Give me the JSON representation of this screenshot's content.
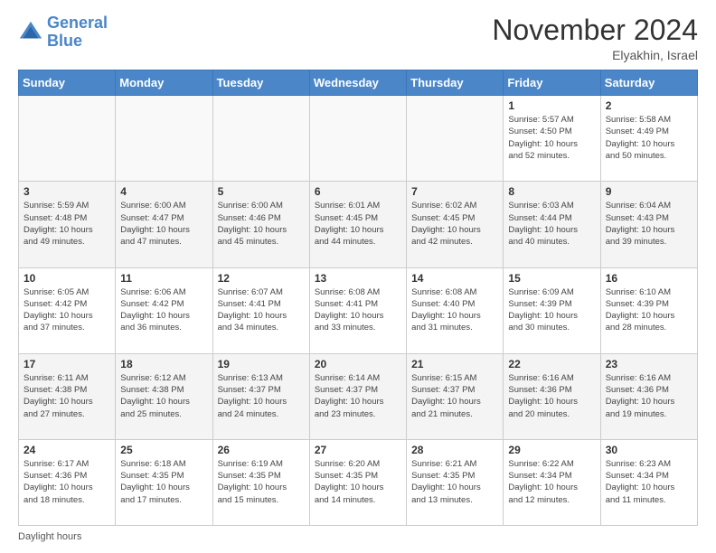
{
  "logo": {
    "line1": "General",
    "line2": "Blue"
  },
  "header": {
    "month": "November 2024",
    "location": "Elyakhin, Israel"
  },
  "footer": {
    "daylight_label": "Daylight hours"
  },
  "weekdays": [
    "Sunday",
    "Monday",
    "Tuesday",
    "Wednesday",
    "Thursday",
    "Friday",
    "Saturday"
  ],
  "weeks": [
    [
      {
        "day": "",
        "info": ""
      },
      {
        "day": "",
        "info": ""
      },
      {
        "day": "",
        "info": ""
      },
      {
        "day": "",
        "info": ""
      },
      {
        "day": "",
        "info": ""
      },
      {
        "day": "1",
        "info": "Sunrise: 5:57 AM\nSunset: 4:50 PM\nDaylight: 10 hours\nand 52 minutes."
      },
      {
        "day": "2",
        "info": "Sunrise: 5:58 AM\nSunset: 4:49 PM\nDaylight: 10 hours\nand 50 minutes."
      }
    ],
    [
      {
        "day": "3",
        "info": "Sunrise: 5:59 AM\nSunset: 4:48 PM\nDaylight: 10 hours\nand 49 minutes."
      },
      {
        "day": "4",
        "info": "Sunrise: 6:00 AM\nSunset: 4:47 PM\nDaylight: 10 hours\nand 47 minutes."
      },
      {
        "day": "5",
        "info": "Sunrise: 6:00 AM\nSunset: 4:46 PM\nDaylight: 10 hours\nand 45 minutes."
      },
      {
        "day": "6",
        "info": "Sunrise: 6:01 AM\nSunset: 4:45 PM\nDaylight: 10 hours\nand 44 minutes."
      },
      {
        "day": "7",
        "info": "Sunrise: 6:02 AM\nSunset: 4:45 PM\nDaylight: 10 hours\nand 42 minutes."
      },
      {
        "day": "8",
        "info": "Sunrise: 6:03 AM\nSunset: 4:44 PM\nDaylight: 10 hours\nand 40 minutes."
      },
      {
        "day": "9",
        "info": "Sunrise: 6:04 AM\nSunset: 4:43 PM\nDaylight: 10 hours\nand 39 minutes."
      }
    ],
    [
      {
        "day": "10",
        "info": "Sunrise: 6:05 AM\nSunset: 4:42 PM\nDaylight: 10 hours\nand 37 minutes."
      },
      {
        "day": "11",
        "info": "Sunrise: 6:06 AM\nSunset: 4:42 PM\nDaylight: 10 hours\nand 36 minutes."
      },
      {
        "day": "12",
        "info": "Sunrise: 6:07 AM\nSunset: 4:41 PM\nDaylight: 10 hours\nand 34 minutes."
      },
      {
        "day": "13",
        "info": "Sunrise: 6:08 AM\nSunset: 4:41 PM\nDaylight: 10 hours\nand 33 minutes."
      },
      {
        "day": "14",
        "info": "Sunrise: 6:08 AM\nSunset: 4:40 PM\nDaylight: 10 hours\nand 31 minutes."
      },
      {
        "day": "15",
        "info": "Sunrise: 6:09 AM\nSunset: 4:39 PM\nDaylight: 10 hours\nand 30 minutes."
      },
      {
        "day": "16",
        "info": "Sunrise: 6:10 AM\nSunset: 4:39 PM\nDaylight: 10 hours\nand 28 minutes."
      }
    ],
    [
      {
        "day": "17",
        "info": "Sunrise: 6:11 AM\nSunset: 4:38 PM\nDaylight: 10 hours\nand 27 minutes."
      },
      {
        "day": "18",
        "info": "Sunrise: 6:12 AM\nSunset: 4:38 PM\nDaylight: 10 hours\nand 25 minutes."
      },
      {
        "day": "19",
        "info": "Sunrise: 6:13 AM\nSunset: 4:37 PM\nDaylight: 10 hours\nand 24 minutes."
      },
      {
        "day": "20",
        "info": "Sunrise: 6:14 AM\nSunset: 4:37 PM\nDaylight: 10 hours\nand 23 minutes."
      },
      {
        "day": "21",
        "info": "Sunrise: 6:15 AM\nSunset: 4:37 PM\nDaylight: 10 hours\nand 21 minutes."
      },
      {
        "day": "22",
        "info": "Sunrise: 6:16 AM\nSunset: 4:36 PM\nDaylight: 10 hours\nand 20 minutes."
      },
      {
        "day": "23",
        "info": "Sunrise: 6:16 AM\nSunset: 4:36 PM\nDaylight: 10 hours\nand 19 minutes."
      }
    ],
    [
      {
        "day": "24",
        "info": "Sunrise: 6:17 AM\nSunset: 4:36 PM\nDaylight: 10 hours\nand 18 minutes."
      },
      {
        "day": "25",
        "info": "Sunrise: 6:18 AM\nSunset: 4:35 PM\nDaylight: 10 hours\nand 17 minutes."
      },
      {
        "day": "26",
        "info": "Sunrise: 6:19 AM\nSunset: 4:35 PM\nDaylight: 10 hours\nand 15 minutes."
      },
      {
        "day": "27",
        "info": "Sunrise: 6:20 AM\nSunset: 4:35 PM\nDaylight: 10 hours\nand 14 minutes."
      },
      {
        "day": "28",
        "info": "Sunrise: 6:21 AM\nSunset: 4:35 PM\nDaylight: 10 hours\nand 13 minutes."
      },
      {
        "day": "29",
        "info": "Sunrise: 6:22 AM\nSunset: 4:34 PM\nDaylight: 10 hours\nand 12 minutes."
      },
      {
        "day": "30",
        "info": "Sunrise: 6:23 AM\nSunset: 4:34 PM\nDaylight: 10 hours\nand 11 minutes."
      }
    ]
  ]
}
